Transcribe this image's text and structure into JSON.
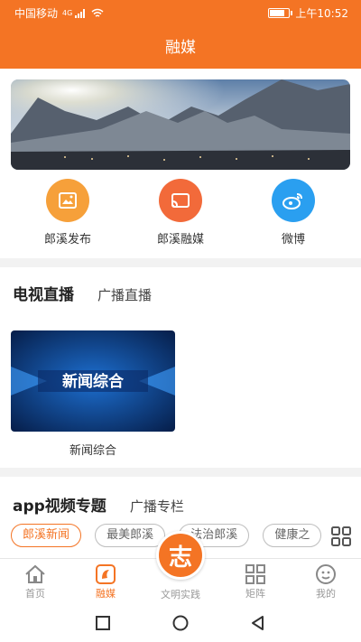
{
  "status_bar": {
    "carrier": "中国移动",
    "network": "4G",
    "time": "上午10:52"
  },
  "header": {
    "title": "融媒"
  },
  "quick_actions": [
    {
      "label": "郎溪发布",
      "icon": "picture-icon",
      "color": "#f6a03a"
    },
    {
      "label": "郎溪融媒",
      "icon": "cast-icon",
      "color": "#f26a3a"
    },
    {
      "label": "微博",
      "icon": "weibo-icon",
      "color": "#2a9ff0"
    }
  ],
  "live_section": {
    "tabs": [
      "电视直播",
      "广播直播"
    ],
    "video": {
      "title_on_image": "新闻综合",
      "caption": "新闻综合"
    }
  },
  "topics_section": {
    "tabs": [
      "app视频专题",
      "广播专栏"
    ],
    "chips": [
      "郎溪新闻",
      "最美郎溪",
      "法治郎溪",
      "健康之"
    ]
  },
  "bottom_nav": {
    "items": [
      "首页",
      "融媒",
      "文明实践",
      "矩阵",
      "我的"
    ],
    "center_glyph": "志",
    "active": "融媒"
  },
  "colors": {
    "accent": "#f47424"
  }
}
